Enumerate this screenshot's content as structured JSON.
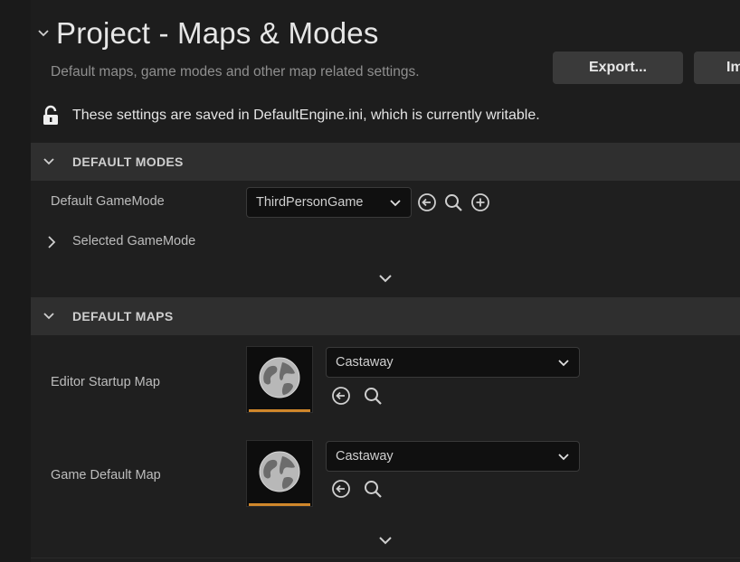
{
  "header": {
    "title": "Project - Maps & Modes",
    "subtitle": "Default maps, game modes and other map related settings.",
    "export_label": "Export...",
    "import_label": "Im",
    "lock_notice": "These settings are saved in DefaultEngine.ini, which is currently writable."
  },
  "default_modes": {
    "section_label": "DEFAULT MODES",
    "default_gamemode_label": "Default GameMode",
    "default_gamemode_value": "ThirdPersonGame",
    "selected_gamemode_label": "Selected GameMode"
  },
  "default_maps": {
    "section_label": "DEFAULT MAPS",
    "editor_startup_label": "Editor Startup Map",
    "editor_startup_value": "Castaway",
    "game_default_label": "Game Default Map",
    "game_default_value": "Castaway"
  },
  "colors": {
    "background": "#1f1f1f",
    "section_header": "#2f2f2f",
    "accent_orange": "#d0872b",
    "button": "#3a3a3a"
  },
  "icons": [
    "chevron-down-icon",
    "lock-icon",
    "browse-back-icon",
    "search-icon",
    "add-icon",
    "chevron-right-icon",
    "globe-icon"
  ]
}
